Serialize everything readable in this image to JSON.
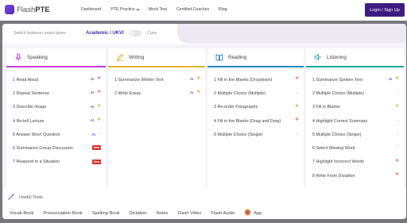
{
  "brand": {
    "name_light": "Flash",
    "name_bold": "PTE"
  },
  "nav": [
    {
      "label": "Dashboard",
      "caret": false
    },
    {
      "label": "PTE Practice",
      "caret": true
    },
    {
      "label": "Mock Test",
      "caret": false
    },
    {
      "label": "Certified Coaches",
      "caret": false
    },
    {
      "label": "Blog",
      "caret": false
    }
  ],
  "login_label": "Login / Sign Up",
  "exam_switch": {
    "label": "Switch between exam types",
    "option_active": "Academic / UKVI",
    "option_other": "Core"
  },
  "colors": {
    "speaking": "#c13fd9",
    "writing": "#e2b32e",
    "reading": "#2b86c4",
    "listening": "#1ca49a",
    "accent": "#3d1c82"
  },
  "columns": [
    {
      "title": "Speaking",
      "icon": "microphone-icon",
      "items": [
        {
          "label": "1 Read Aloud",
          "badges": [
            "ai",
            "star-red"
          ]
        },
        {
          "label": "2 Repeat Sentence",
          "badges": [
            "ai",
            "star-red"
          ]
        },
        {
          "label": "3 Describe Image",
          "badges": [
            "ai",
            "star"
          ]
        },
        {
          "label": "4 Re-tell Lecture",
          "badges": [
            "ai",
            "star"
          ]
        },
        {
          "label": "5 Answer Short Question",
          "badges": [
            "ai",
            "dash"
          ]
        },
        {
          "label": "6 Summarize Group Discussion",
          "badges": [
            "new"
          ]
        },
        {
          "label": "7 Respond to a Situation",
          "badges": [
            "new"
          ]
        }
      ]
    },
    {
      "title": "Writing",
      "icon": "pencil-icon",
      "items": [
        {
          "label": "1 Summarize Written Text",
          "badges": [
            "ai",
            "star"
          ]
        },
        {
          "label": "2 Write Essay",
          "badges": [
            "ai",
            "star"
          ]
        }
      ]
    },
    {
      "title": "Reading",
      "icon": "book-icon",
      "items": [
        {
          "label": "1 Fill in the Blanks (Dropdown)",
          "badges": [
            "star-red"
          ]
        },
        {
          "label": "2 Multiple Choice (Multiple)",
          "badges": [
            "dash"
          ]
        },
        {
          "label": "3 Re-order Paragraphs",
          "badges": [
            "star"
          ]
        },
        {
          "label": "4 Fill in the Blanks (Drag and Drop)",
          "badges": [
            "star-red"
          ]
        },
        {
          "label": "5 Multiple Choice (Single)",
          "badges": [
            "dash"
          ]
        }
      ]
    },
    {
      "title": "Listening",
      "icon": "speaker-icon",
      "items": [
        {
          "label": "1 Summarize Spoken Text",
          "badges": [
            "ai",
            "star"
          ]
        },
        {
          "label": "2 Multiple Choice (Multiple)",
          "badges": [
            "dash"
          ]
        },
        {
          "label": "3 Fill in Blanks",
          "badges": [
            "star"
          ]
        },
        {
          "label": "4 Highlight Correct Summary",
          "badges": [
            "dash"
          ]
        },
        {
          "label": "5 Multiple Choice (Single)",
          "badges": [
            "dash"
          ]
        },
        {
          "label": "6 Select Missing Word",
          "badges": [
            "chevron"
          ]
        },
        {
          "label": "7 Highlight Incorrect Words",
          "badges": [
            "star-red"
          ]
        },
        {
          "label": "8 Write From Dictation",
          "badges": [
            "star-red"
          ]
        }
      ]
    }
  ],
  "badge_text": {
    "ai": "AI",
    "new": "New",
    "star": "✲",
    "dash": "–",
    "chevron": "⌃"
  },
  "useful_tools": {
    "title": "Useful Tools",
    "links": [
      "Vocab Book",
      "Pronunciation Book",
      "Spelling Book",
      "Dictation",
      "Notes",
      "Flash Video",
      "Flash Audio",
      "App"
    ]
  }
}
